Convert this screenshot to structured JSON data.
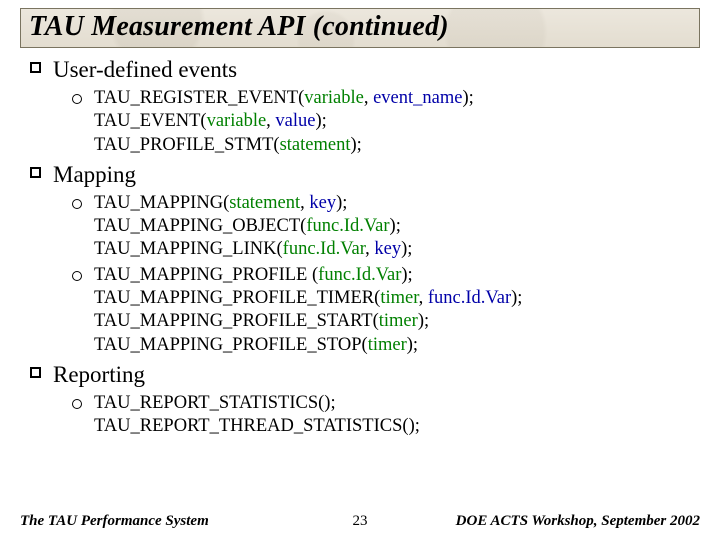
{
  "title": "TAU Measurement API (continued)",
  "sections": [
    {
      "heading": "User-defined events",
      "items": [
        {
          "lines": [
            {
              "fn": "TAU_REGISTER_EVENT",
              "open": "(",
              "params": [
                {
                  "t": "variable",
                  "c": "p1"
                },
                {
                  "t": ", ",
                  "c": ""
                },
                {
                  "t": "event_name",
                  "c": "p2"
                }
              ],
              "close": ");"
            },
            {
              "fn": "TAU_EVENT",
              "open": "(",
              "params": [
                {
                  "t": "variable",
                  "c": "p1"
                },
                {
                  "t": ", ",
                  "c": ""
                },
                {
                  "t": "value",
                  "c": "p2"
                }
              ],
              "close": ");"
            },
            {
              "fn": "TAU_PROFILE_STMT",
              "open": "(",
              "params": [
                {
                  "t": "statement",
                  "c": "p1"
                }
              ],
              "close": ");"
            }
          ]
        }
      ]
    },
    {
      "heading": "Mapping",
      "items": [
        {
          "lines": [
            {
              "fn": "TAU_MAPPING",
              "open": "(",
              "params": [
                {
                  "t": "statement",
                  "c": "p1"
                },
                {
                  "t": ", ",
                  "c": ""
                },
                {
                  "t": "key",
                  "c": "p2"
                }
              ],
              "close": ");"
            },
            {
              "fn": "TAU_MAPPING_OBJECT",
              "open": "(",
              "params": [
                {
                  "t": "func.Id.Var",
                  "c": "p1"
                }
              ],
              "close": ");"
            },
            {
              "fn": "TAU_MAPPING_LINK",
              "open": "(",
              "params": [
                {
                  "t": "func.Id.Var",
                  "c": "p1"
                },
                {
                  "t": ", ",
                  "c": ""
                },
                {
                  "t": "key",
                  "c": "p2"
                }
              ],
              "close": ");"
            }
          ]
        },
        {
          "lines": [
            {
              "fn": "TAU_MAPPING_PROFILE ",
              "open": "(",
              "params": [
                {
                  "t": "func.Id.Var",
                  "c": "p1"
                }
              ],
              "close": ");"
            },
            {
              "fn": "TAU_MAPPING_PROFILE_TIMER",
              "open": "(",
              "params": [
                {
                  "t": "timer",
                  "c": "p1"
                },
                {
                  "t": ", ",
                  "c": ""
                },
                {
                  "t": "func.Id.Var",
                  "c": "p2"
                }
              ],
              "close": ");"
            },
            {
              "fn": "TAU_MAPPING_PROFILE_START",
              "open": "(",
              "params": [
                {
                  "t": "timer",
                  "c": "p1"
                }
              ],
              "close": ");"
            },
            {
              "fn": "TAU_MAPPING_PROFILE_STOP",
              "open": "(",
              "params": [
                {
                  "t": "timer",
                  "c": "p1"
                }
              ],
              "close": ");"
            }
          ]
        }
      ]
    },
    {
      "heading": "Reporting",
      "items": [
        {
          "lines": [
            {
              "fn": "TAU_REPORT_STATISTICS",
              "open": "(",
              "params": [],
              "close": ");"
            },
            {
              "fn": "TAU_REPORT_THREAD_STATISTICS",
              "open": "(",
              "params": [],
              "close": ");"
            }
          ]
        }
      ]
    }
  ],
  "footer": {
    "left": "The TAU Performance System",
    "center": "23",
    "right": "DOE ACTS Workshop, September 2002"
  }
}
